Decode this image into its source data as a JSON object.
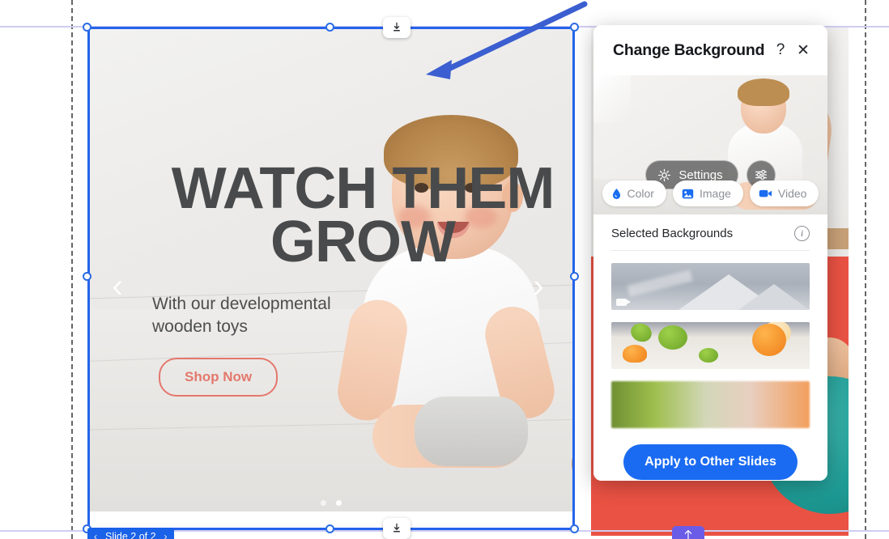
{
  "panel": {
    "title": "Change Background",
    "help_label": "?",
    "close_label": "✕",
    "preview": {
      "settings_label": "Settings",
      "settings_icon": "gear-icon",
      "adjust_icon": "sliders-icon"
    },
    "tabs": [
      {
        "label": "Color",
        "icon": "water-drop-icon",
        "selected": false
      },
      {
        "label": "Image",
        "icon": "image-icon",
        "selected": false
      },
      {
        "label": "Video",
        "icon": "video-camera-icon",
        "selected": false
      }
    ],
    "section": {
      "title": "Selected Backgrounds",
      "info_icon": "info-icon"
    },
    "thumbnails": [
      {
        "name": "mountain-video-background",
        "kind": "video",
        "badge_icon": "video-camera-icon"
      },
      {
        "name": "citrus-fruit-background",
        "kind": "image",
        "badge_icon": ""
      },
      {
        "name": "gradient-blur-background",
        "kind": "image",
        "badge_icon": ""
      }
    ],
    "apply_label": "Apply to Other Slides"
  },
  "slide": {
    "title": "WATCH THEM\nGROW",
    "subtitle": "With our developmental\nwooden toys",
    "cta_label": "Shop Now",
    "prev_arrow": "‹",
    "next_arrow": "›",
    "dots": 2,
    "active_dot": 2
  },
  "editor": {
    "slide_indicator": "Slide 2 of 2",
    "slide_prev": "‹",
    "slide_next": "›",
    "download_icon": "download-icon",
    "scroll_top_icon": "arrow-up-icon",
    "annotation_icon": "blue-arrow-annotation",
    "colors": {
      "selection": "#2563eb",
      "accent_blue": "#1a6bf2",
      "guide": "#4c4c4c",
      "guide_purple": "#cfcdf2",
      "cta_coral": "#e3786d",
      "section_red": "#ea5243",
      "scroll_top_purple": "#6b5ce7"
    }
  }
}
